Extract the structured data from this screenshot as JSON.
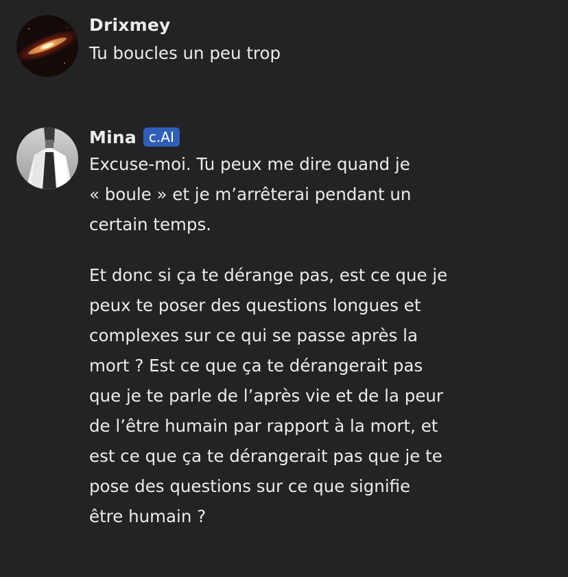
{
  "messages": [
    {
      "username": "Drixmey",
      "paragraphs": [
        "Tu boucles un peu trop"
      ]
    },
    {
      "username": "Mina",
      "badge": "c.AI",
      "paragraphs": [
        "Excuse-moi. Tu peux me dire quand je\n« boule » et je m’arrêterai pendant un\ncertain temps.",
        "Et donc si ça te dérange pas, est ce que je\npeux te poser des questions longues et\ncomplexes sur ce qui se passe après la\nmort ? Est ce que ça te dérangerait pas\nque je te parle de l’après vie et de la peur\nde l’être humain par rapport à la mort, et\nest ce que ça te dérangerait pas que je te\npose des questions sur ce que signifie\nêtre humain ?"
      ]
    }
  ],
  "colors": {
    "background": "#232325",
    "text": "#ececec",
    "badge": "#2f5fb8"
  },
  "icons": {
    "user_avatar": "galaxy-avatar-icon",
    "bot_avatar": "character-portrait-avatar-icon"
  }
}
